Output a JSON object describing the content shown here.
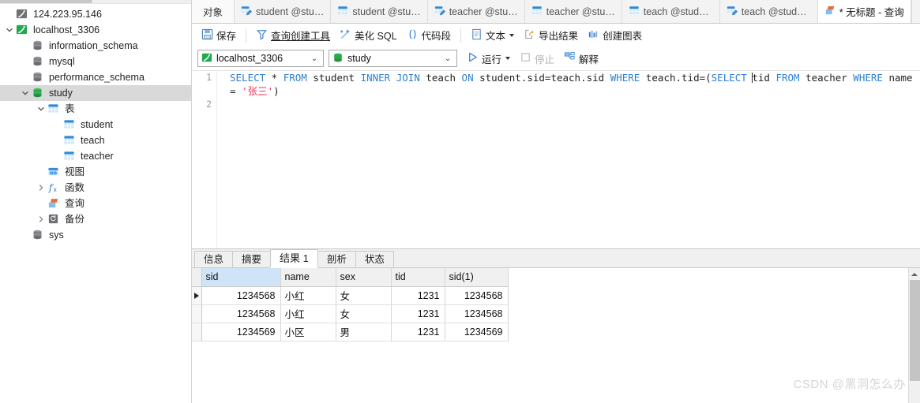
{
  "sidebar": {
    "tree": [
      {
        "label": "124.223.95.146",
        "icon": "connection-gray-icon",
        "indent": 0,
        "twisty": "none",
        "selected": false
      },
      {
        "label": "localhost_3306",
        "icon": "connection-green-icon",
        "indent": 0,
        "twisty": "expanded",
        "selected": false
      },
      {
        "label": "information_schema",
        "icon": "database-gray-icon",
        "indent": 1,
        "twisty": "none",
        "selected": false
      },
      {
        "label": "mysql",
        "icon": "database-gray-icon",
        "indent": 1,
        "twisty": "none",
        "selected": false
      },
      {
        "label": "performance_schema",
        "icon": "database-gray-icon",
        "indent": 1,
        "twisty": "none",
        "selected": false
      },
      {
        "label": "study",
        "icon": "database-green-icon",
        "indent": 1,
        "twisty": "expanded",
        "selected": true
      },
      {
        "label": "表",
        "icon": "table-folder-icon",
        "indent": 2,
        "twisty": "expanded",
        "selected": false
      },
      {
        "label": "student",
        "icon": "table-icon",
        "indent": 3,
        "twisty": "none",
        "selected": false
      },
      {
        "label": "teach",
        "icon": "table-icon",
        "indent": 3,
        "twisty": "none",
        "selected": false
      },
      {
        "label": "teacher",
        "icon": "table-icon",
        "indent": 3,
        "twisty": "none",
        "selected": false
      },
      {
        "label": "视图",
        "icon": "view-icon",
        "indent": 2,
        "twisty": "none",
        "selected": false
      },
      {
        "label": "函数",
        "icon": "function-icon",
        "indent": 2,
        "twisty": "collapsed",
        "selected": false
      },
      {
        "label": "查询",
        "icon": "query-icon",
        "indent": 2,
        "twisty": "none",
        "selected": false
      },
      {
        "label": "备份",
        "icon": "backup-icon",
        "indent": 2,
        "twisty": "collapsed",
        "selected": false
      },
      {
        "label": "sys",
        "icon": "database-gray-icon",
        "indent": 1,
        "twisty": "none",
        "selected": false
      }
    ]
  },
  "tabstrip": {
    "object_tab": "对象",
    "tabs": [
      {
        "label": "student @stu…",
        "icon": "table-designer-icon",
        "active": false
      },
      {
        "label": "student @stu…",
        "icon": "table-icon",
        "active": false
      },
      {
        "label": "teacher @stu…",
        "icon": "table-designer-icon",
        "active": false
      },
      {
        "label": "teacher @stu…",
        "icon": "table-icon",
        "active": false
      },
      {
        "label": "teach @study …",
        "icon": "table-icon",
        "active": false
      },
      {
        "label": "teach @study …",
        "icon": "table-designer-icon",
        "active": false
      },
      {
        "label": "* 无标题 - 查询",
        "icon": "query-icon",
        "active": true
      }
    ]
  },
  "toolbar": {
    "save": "保存",
    "query_builder": "查询创建工具",
    "beautify_sql": "美化 SQL",
    "code_snippet": "代码段",
    "text": "文本",
    "export_result": "导出结果",
    "create_chart": "创建图表"
  },
  "toolbar2": {
    "connection": "localhost_3306",
    "database": "study",
    "run": "运行",
    "stop": "停止",
    "explain": "解释"
  },
  "editor": {
    "line_numbers": [
      "1",
      "2"
    ],
    "sql_tokens": [
      {
        "t": "SELECT",
        "k": "kw"
      },
      {
        "t": " * ",
        "k": ""
      },
      {
        "t": "FROM",
        "k": "kw"
      },
      {
        "t": " student ",
        "k": ""
      },
      {
        "t": "INNER",
        "k": "kw"
      },
      {
        "t": " ",
        "k": ""
      },
      {
        "t": "JOIN",
        "k": "kw"
      },
      {
        "t": " teach ",
        "k": ""
      },
      {
        "t": "ON",
        "k": "kw"
      },
      {
        "t": " student.sid=teach.sid ",
        "k": ""
      },
      {
        "t": "WHERE",
        "k": "kw"
      },
      {
        "t": " teach.tid=(",
        "k": ""
      },
      {
        "t": "SELECT",
        "k": "kw"
      },
      {
        "t": " ",
        "k": "cursor"
      },
      {
        "t": "tid ",
        "k": ""
      },
      {
        "t": "FROM",
        "k": "kw"
      },
      {
        "t": " teacher ",
        "k": ""
      },
      {
        "t": "WHERE",
        "k": "kw"
      },
      {
        "t": " name = ",
        "k": ""
      },
      {
        "t": "'张三'",
        "k": "str"
      },
      {
        "t": ")",
        "k": ""
      }
    ],
    "sql_plain": "SELECT * FROM student INNER JOIN teach ON student.sid=teach.sid WHERE teach.tid=(SELECT tid FROM teacher WHERE name = '张三')"
  },
  "result": {
    "tabs": [
      {
        "label": "信息",
        "active": false
      },
      {
        "label": "摘要",
        "active": false
      },
      {
        "label": "结果 1",
        "active": true
      },
      {
        "label": "剖析",
        "active": false
      },
      {
        "label": "状态",
        "active": false
      }
    ],
    "columns": [
      "sid",
      "name",
      "sex",
      "tid",
      "sid(1)"
    ],
    "selected_column": "sid",
    "rows": [
      {
        "current": true,
        "sid": "1234568",
        "name": "小红",
        "sex": "女",
        "tid": "1231",
        "sid1": "1234568"
      },
      {
        "current": false,
        "sid": "1234568",
        "name": "小红",
        "sex": "女",
        "tid": "1231",
        "sid1": "1234568"
      },
      {
        "current": false,
        "sid": "1234569",
        "name": "小区",
        "sex": "男",
        "tid": "1231",
        "sid1": "1234569"
      }
    ]
  },
  "watermark": "CSDN @黑洞怎么办",
  "colors": {
    "accent": "#2f7fd1",
    "selection": "#cfe4f7",
    "string": "#e8355a",
    "green": "#2aa84a",
    "orange": "#ef6a34"
  }
}
